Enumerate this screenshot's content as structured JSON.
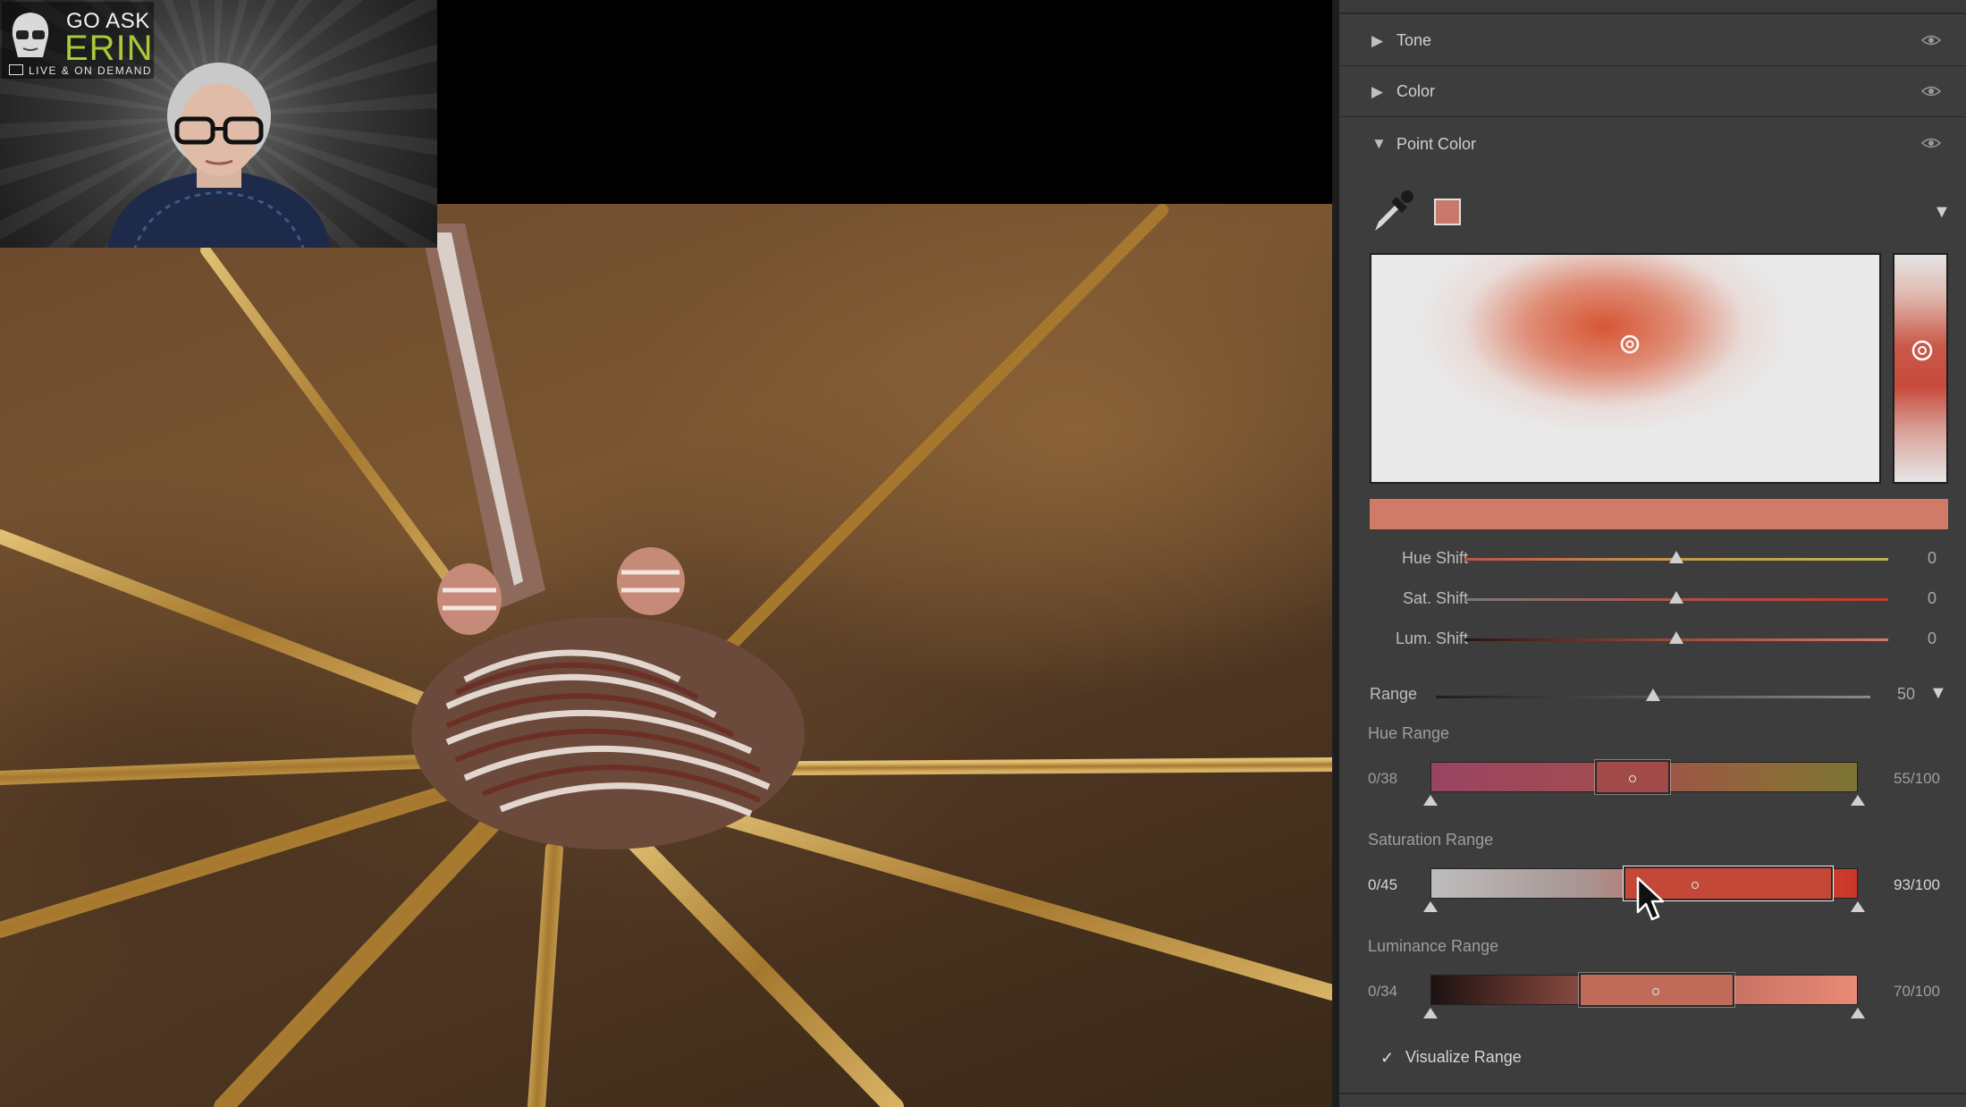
{
  "webcam": {
    "logo_line1": "GO ASK",
    "logo_line2": "ERIN",
    "logo_tagline": "LIVE & ON DEMAND"
  },
  "panel": {
    "sections": [
      {
        "label": "Tone",
        "expanded": false
      },
      {
        "label": "Color",
        "expanded": false
      },
      {
        "label": "Point Color",
        "expanded": true
      }
    ],
    "point_color": {
      "swatch_color": "#c9786c",
      "shifts": [
        {
          "label": "Hue Shift",
          "value": "0",
          "fraction": 0.5
        },
        {
          "label": "Sat. Shift",
          "value": "0",
          "fraction": 0.5
        },
        {
          "label": "Lum. Shift",
          "value": "0",
          "fraction": 0.5
        }
      ],
      "range": {
        "label": "Range",
        "value": "50",
        "fraction": 0.5
      },
      "hue_range": {
        "title": "Hue Range",
        "low": "0/38",
        "high": "55/100"
      },
      "saturation_range": {
        "title": "Saturation Range",
        "low": "0/45",
        "high": "93/100"
      },
      "luminance_range": {
        "title": "Luminance Range",
        "low": "0/34",
        "high": "70/100"
      },
      "visualize_range": {
        "label": "Visualize Range",
        "checked": true
      }
    }
  }
}
